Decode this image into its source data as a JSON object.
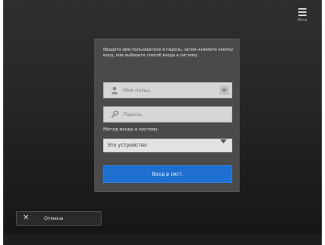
{
  "menu": {
    "label": "Меню"
  },
  "dialog": {
    "message": "Введите имя пользователя и пароль, затем нажмите кнопку вход, или выберите способ входа в систему.",
    "username_placeholder": "Имя польз.",
    "password_placeholder": "Пароль",
    "method_label": "Метод входа в систему",
    "method_value": "Это устройство",
    "submit_label": "Вход в сист."
  },
  "cancel": {
    "label": "Отмена"
  }
}
